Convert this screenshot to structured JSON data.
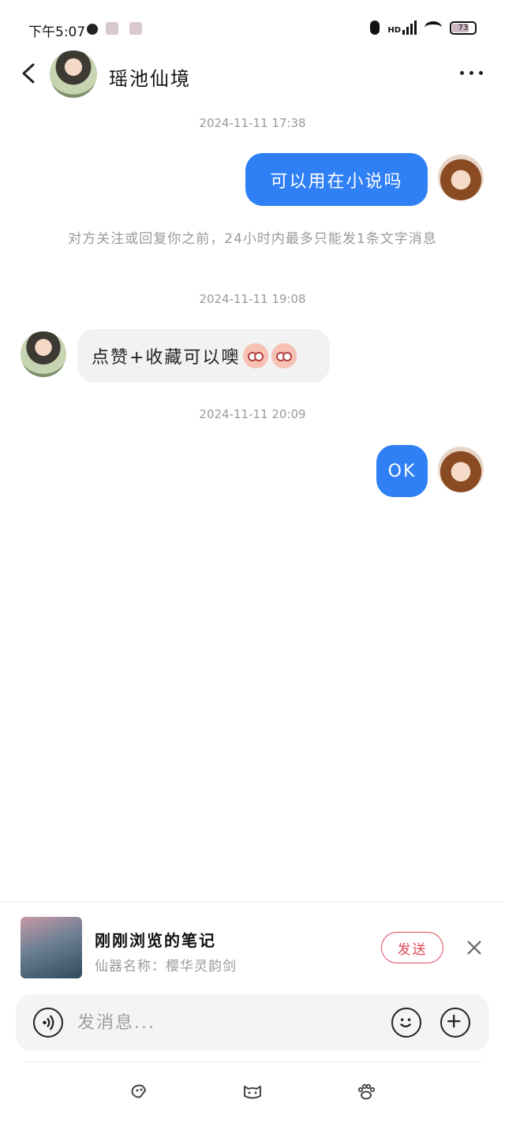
{
  "status_bar": {
    "time": "下午5:07",
    "network": "HD",
    "battery": "73"
  },
  "header": {
    "title": "瑶池仙境"
  },
  "messages": [
    {
      "type": "timestamp",
      "text": "2024-11-11 17:38"
    },
    {
      "type": "sent",
      "text": "可以用在小说吗"
    },
    {
      "type": "notice",
      "text": "对方关注或回复你之前，24小时内最多只能发1条文字消息"
    },
    {
      "type": "timestamp",
      "text": "2024-11-11 19:08"
    },
    {
      "type": "received",
      "text": "点赞+收藏可以噢",
      "emoji_count": 2
    },
    {
      "type": "timestamp",
      "text": "2024-11-11 20:09"
    },
    {
      "type": "sent",
      "text": "OK"
    }
  ],
  "note_card": {
    "title": "刚刚浏览的笔记",
    "subtitle": "仙器名称：樱华灵韵剑",
    "send_label": "发送"
  },
  "composer": {
    "placeholder": "发消息..."
  },
  "colors": {
    "sent_bubble": "#2f7ff5",
    "received_bubble": "#f2f2f2",
    "send_button": "#e04a5a"
  }
}
